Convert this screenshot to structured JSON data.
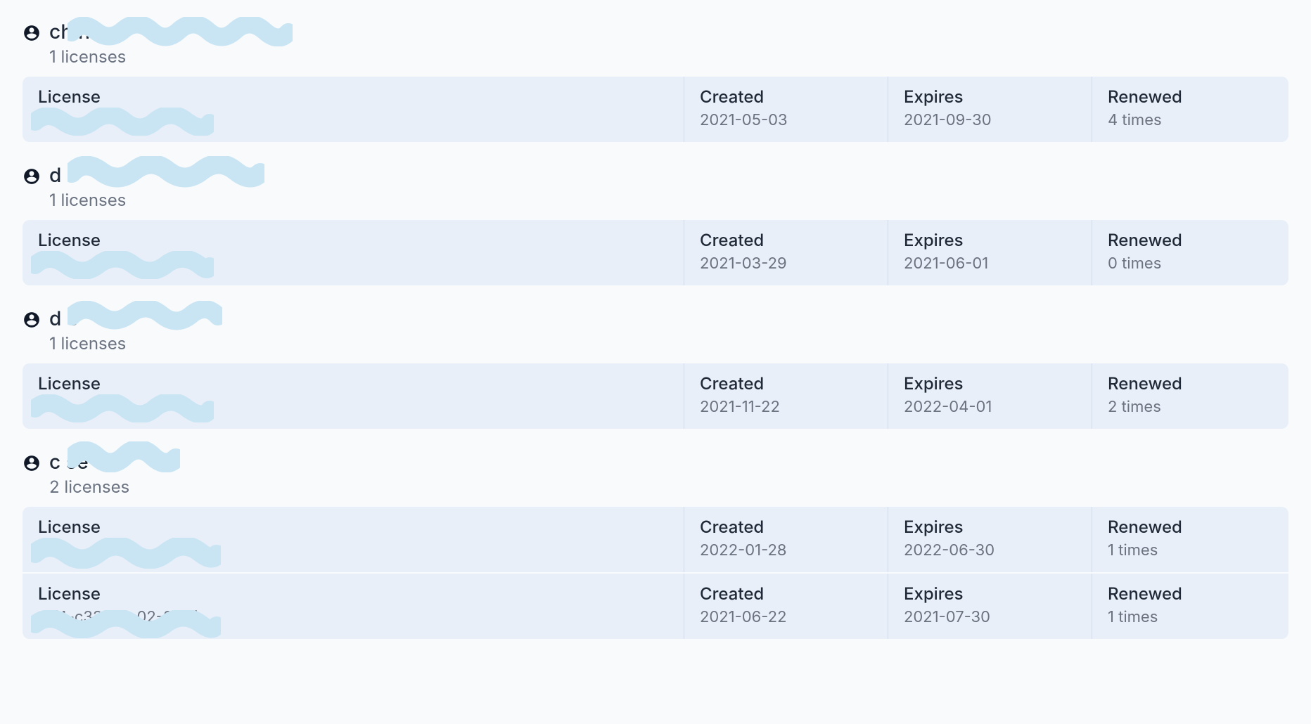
{
  "labels": {
    "license": "License",
    "created": "Created",
    "expires": "Expires",
    "renewed": "Renewed"
  },
  "users": [
    {
      "name_visible": "ch                                          n",
      "licenses_count": "1 licenses",
      "licenses": [
        {
          "license_visible": "",
          "created": "2021-05-03",
          "expires": "2021-09-30",
          "renewed": "4 times"
        }
      ]
    },
    {
      "name_visible": "d                                   e",
      "licenses_count": "1 licenses",
      "licenses": [
        {
          "license_visible": "",
          "created": "2021-03-29",
          "expires": "2021-06-01",
          "renewed": "0 times"
        }
      ]
    },
    {
      "name_visible": "d                           e",
      "licenses_count": "1 licenses",
      "licenses": [
        {
          "license_visible": "",
          "created": "2021-11-22",
          "expires": "2022-04-01",
          "renewed": "2 times"
        }
      ]
    },
    {
      "name_visible": "c               se",
      "licenses_count": "2 licenses",
      "licenses": [
        {
          "license_visible": "",
          "created": "2022-01-28",
          "expires": "2022-06-30",
          "renewed": "1 times"
        },
        {
          "license_visible": "dff4-c336-cc02-85bf",
          "created": "2021-06-22",
          "expires": "2021-07-30",
          "renewed": "1 times"
        }
      ]
    }
  ]
}
